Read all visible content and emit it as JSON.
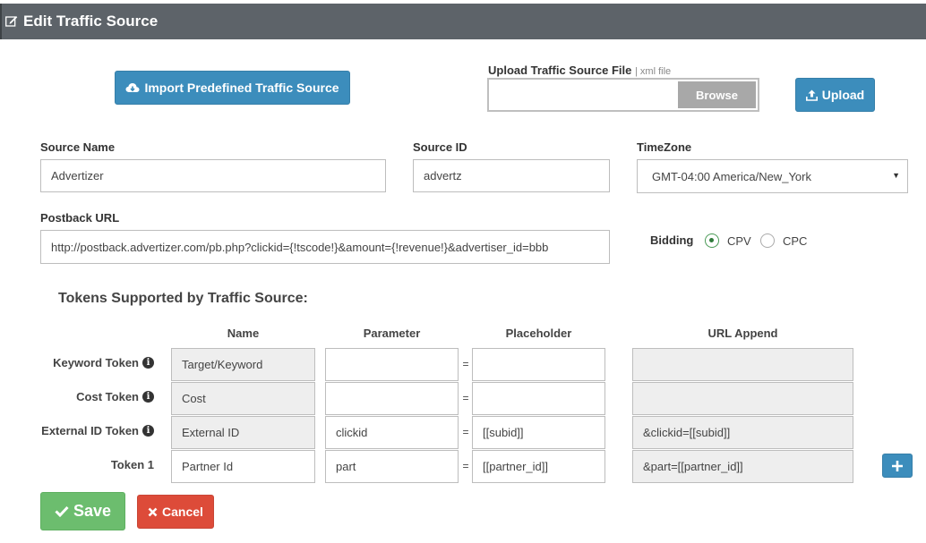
{
  "header": {
    "title": "Edit Traffic Source",
    "icon": "edit-icon"
  },
  "import_button": {
    "label": "Import Predefined Traffic Source",
    "icon": "cloud-download-icon"
  },
  "upload_file": {
    "label": "Upload Traffic Source File",
    "hint": "| xml file",
    "value": "",
    "browse_label": "Browse",
    "upload_label": "Upload",
    "upload_icon": "upload-icon"
  },
  "form": {
    "source_name": {
      "label": "Source Name",
      "value": "Advertizer"
    },
    "source_id": {
      "label": "Source ID",
      "value": "advertz"
    },
    "timezone": {
      "label": "TimeZone",
      "value": "GMT-04:00 America/New_York"
    },
    "postback_url": {
      "label": "Postback URL",
      "value": "http://postback.advertizer.com/pb.php?clickid={!tscode!}&amount={!revenue!}&advertiser_id=bbb"
    },
    "bidding": {
      "label": "Bidding",
      "options": [
        {
          "label": "CPV",
          "selected": true
        },
        {
          "label": "CPC",
          "selected": false
        }
      ]
    }
  },
  "tokens": {
    "title": "Tokens Supported by Traffic Source:",
    "columns": [
      "Name",
      "Parameter",
      "Placeholder",
      "URL Append"
    ],
    "rows": [
      {
        "label": "Keyword Token",
        "info": true,
        "name": "Target/Keyword",
        "parameter": "",
        "equals": "=",
        "placeholder": "",
        "url_append": ""
      },
      {
        "label": "Cost Token",
        "info": true,
        "name": "Cost",
        "parameter": "",
        "equals": "=",
        "placeholder": "",
        "url_append": ""
      },
      {
        "label": "External ID Token",
        "info": true,
        "name": "External ID",
        "parameter": "clickid",
        "equals": "=",
        "placeholder": "[[subid]]",
        "url_append": "&clickid=[[subid]]"
      },
      {
        "label": "Token 1",
        "info": false,
        "name": "Partner Id",
        "parameter": "part",
        "equals": "=",
        "placeholder": "[[partner_id]]",
        "url_append": "&part=[[partner_id]]"
      }
    ],
    "add_button_icon": "plus-icon"
  },
  "actions": {
    "save_label": "Save",
    "cancel_label": "Cancel"
  },
  "colors": {
    "header": "#5d6369",
    "primary": "#3c8dbc",
    "success": "#6cbd6e",
    "danger": "#dd4b39"
  }
}
